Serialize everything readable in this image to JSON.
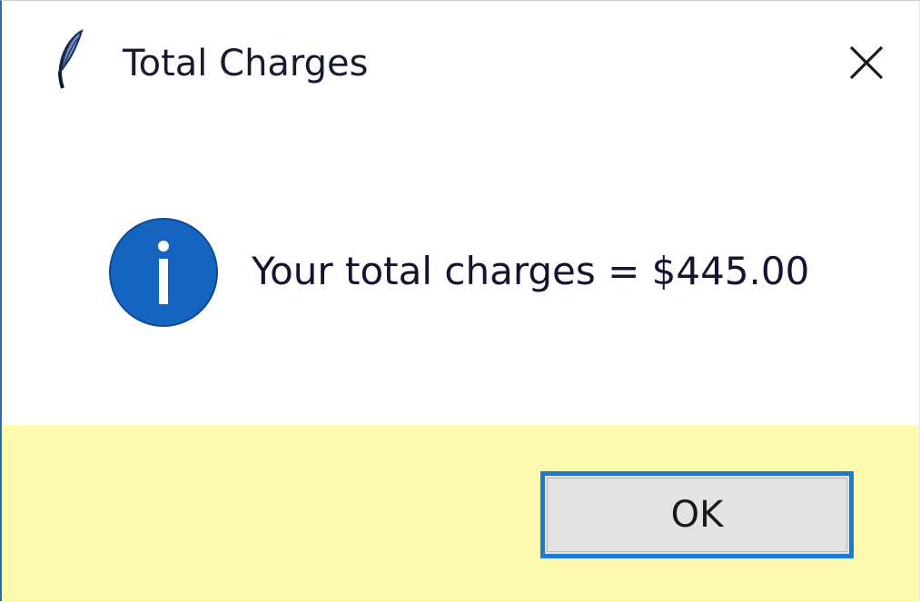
{
  "window": {
    "title": "Total Charges",
    "app_icon": "feather-icon",
    "close_icon": "close-icon"
  },
  "dialog": {
    "icon": "info-icon",
    "message": "Your total charges = $445.00"
  },
  "footer": {
    "ok_label": "OK"
  },
  "colors": {
    "footer_background": "#fefbb1",
    "info_icon": "#1565c0",
    "button_focus_border": "#1f78d1",
    "button_background": "#e3e3e3"
  }
}
